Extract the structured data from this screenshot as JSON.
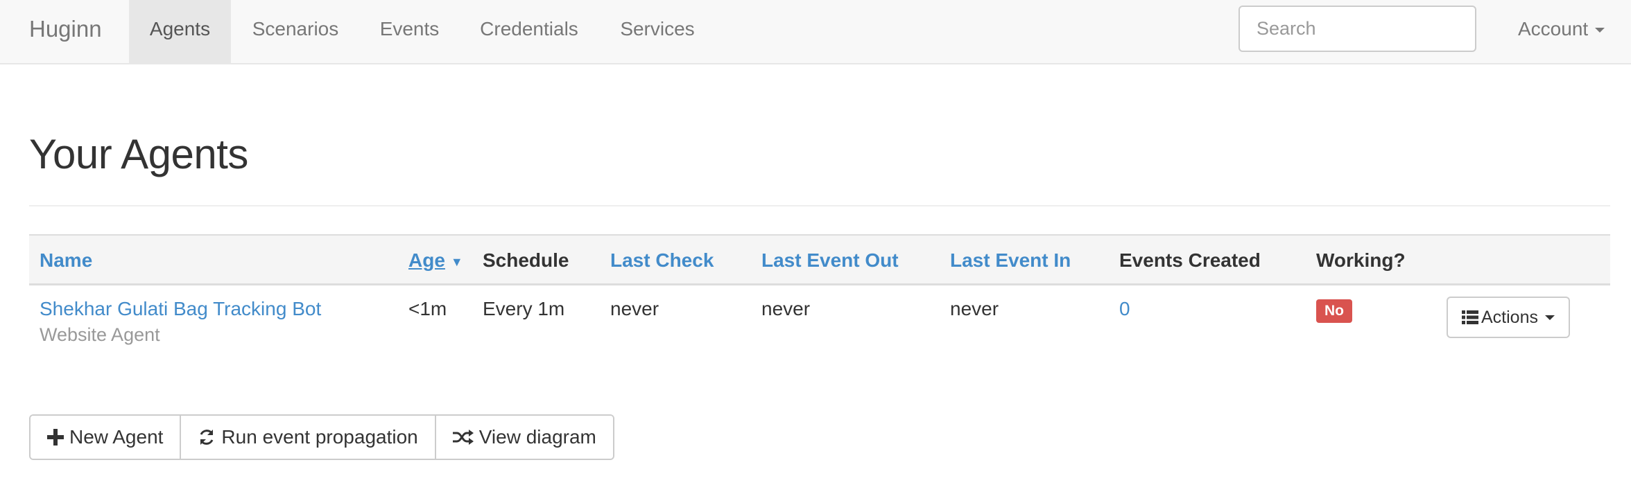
{
  "navbar": {
    "brand": "Huginn",
    "items": [
      {
        "label": "Agents",
        "active": true
      },
      {
        "label": "Scenarios"
      },
      {
        "label": "Events"
      },
      {
        "label": "Credentials"
      },
      {
        "label": "Services"
      }
    ],
    "search_placeholder": "Search",
    "account_label": "Account"
  },
  "page": {
    "title": "Your Agents"
  },
  "table": {
    "columns": {
      "name": "Name",
      "age": "Age",
      "schedule": "Schedule",
      "last_check": "Last Check",
      "last_event_out": "Last Event Out",
      "last_event_in": "Last Event In",
      "events_created": "Events Created",
      "working": "Working?"
    },
    "rows": [
      {
        "name": "Shekhar Gulati Bag Tracking Bot",
        "type": "Website Agent",
        "age": "<1m",
        "schedule": "Every 1m",
        "last_check": "never",
        "last_event_out": "never",
        "last_event_in": "never",
        "events_created": "0",
        "working": "No",
        "actions_label": "Actions"
      }
    ]
  },
  "buttons": {
    "new_agent": "New Agent",
    "run_propagation": "Run event propagation",
    "view_diagram": "View diagram"
  },
  "icons": {
    "sort": "caret-down-icon",
    "actions": "list-icon",
    "new_agent": "plus-icon",
    "run_propagation": "refresh-icon",
    "view_diagram": "random-icon"
  },
  "colors": {
    "link": "#428bca",
    "danger": "#d9534f",
    "navbar_bg": "#f8f8f8",
    "nav_active_bg": "#e7e7e7"
  }
}
